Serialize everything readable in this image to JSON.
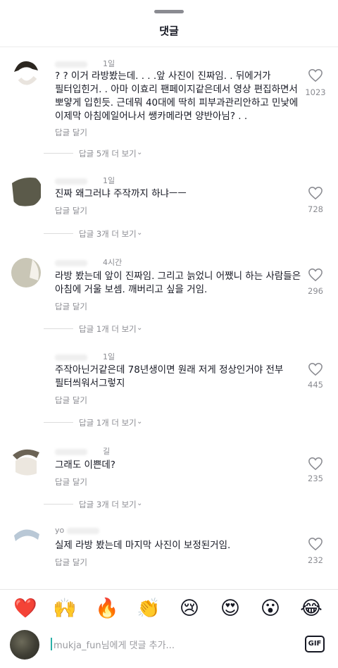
{
  "header": {
    "title": "댓글"
  },
  "comments": [
    {
      "time": "1일",
      "text": "? ? 이거 라방봤는데. . . .앞 사진이 진짜임. . 뒤에거가 필터입힌거. . 아마 이효리 팬페이지같은데서 영상 편집하면서 뽀얗게 입힌듯. 근데뭐 40대에 딱히 피부과관리안하고 민낯에 이제막 아침에일어나서 쌩카메라면 양반아님? . .",
      "reply_label": "답글 달기",
      "likes": "1023",
      "more_replies": "답글 5개 더 보기"
    },
    {
      "time": "1일",
      "text": "진짜 왜그러냐 주작까지 하냐ㅡㅡ",
      "reply_label": "답글 달기",
      "likes": "728",
      "more_replies": "답글 3개 더 보기"
    },
    {
      "time": "4시간",
      "text": "라방 봤는데 앞이 진짜임. 그리고 늙었니 어쨌니 하는 사람들은 아침에 거울 보셈. 깨버리고 싶을 거임.",
      "reply_label": "답글 달기",
      "likes": "296",
      "more_replies": "답글 1개 더 보기"
    },
    {
      "time": "1일",
      "text": "주작아닌거같은데 78년생이면  원래 저게 정상인거야 전부 필터씌워서그렇지",
      "reply_label": "답글 달기",
      "likes": "445",
      "more_replies": "답글 1개 더 보기"
    },
    {
      "time": "길",
      "text": "그래도 이쁜데?",
      "reply_label": "답글 달기",
      "likes": "235",
      "more_replies": "답글 3개 더 보기"
    },
    {
      "time": "yo",
      "text": "실제 라방 봤는데 마지막 사진이 보정된거임.",
      "reply_label": "답글 달기",
      "likes": "232"
    }
  ],
  "emoji_bar": [
    "❤️",
    "🙌",
    "🔥",
    "👏",
    "😢",
    "😍",
    "😮",
    "😂"
  ],
  "input": {
    "placeholder": "mukja_fun님에게 댓글 추가...",
    "gif_label": "GIF"
  }
}
